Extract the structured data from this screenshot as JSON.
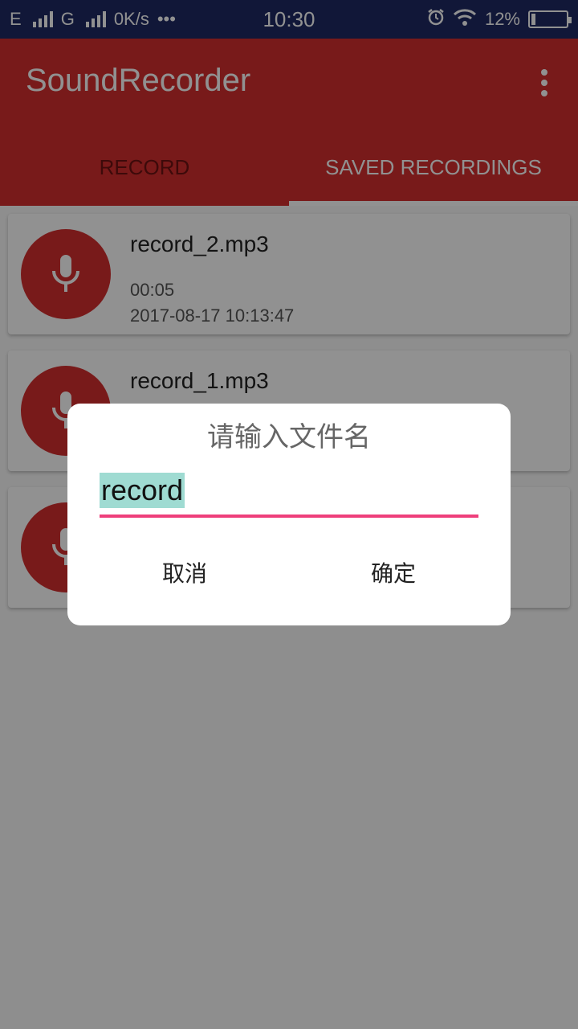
{
  "status_bar": {
    "left_text": "E",
    "network_g": "G",
    "speed": "0K/s",
    "dots": "•••",
    "time": "10:30",
    "battery_percent": "12%",
    "battery_level": 0.12,
    "icons": [
      "signal-icon",
      "alarm-icon",
      "wifi-icon",
      "battery-icon"
    ]
  },
  "app_bar": {
    "title": "SoundRecorder",
    "menu_icon": "overflow-menu-icon",
    "color": "#d32f2f"
  },
  "tabs": [
    {
      "label": "RECORD",
      "active": false
    },
    {
      "label": "SAVED RECORDINGS",
      "active": true
    }
  ],
  "recordings": [
    {
      "name": "record_2.mp3",
      "duration": "00:05",
      "date": "2017-08-17 10:13:47"
    },
    {
      "name": "record_1.mp3",
      "duration": "",
      "date": ""
    },
    {
      "name": "",
      "duration": "",
      "date": ""
    }
  ],
  "dialog": {
    "title": "请输入文件名",
    "input_value": "record",
    "cancel_label": "取消",
    "ok_label": "确定",
    "accent": "#ee3f7b",
    "selection_color": "#9fdbd2"
  }
}
